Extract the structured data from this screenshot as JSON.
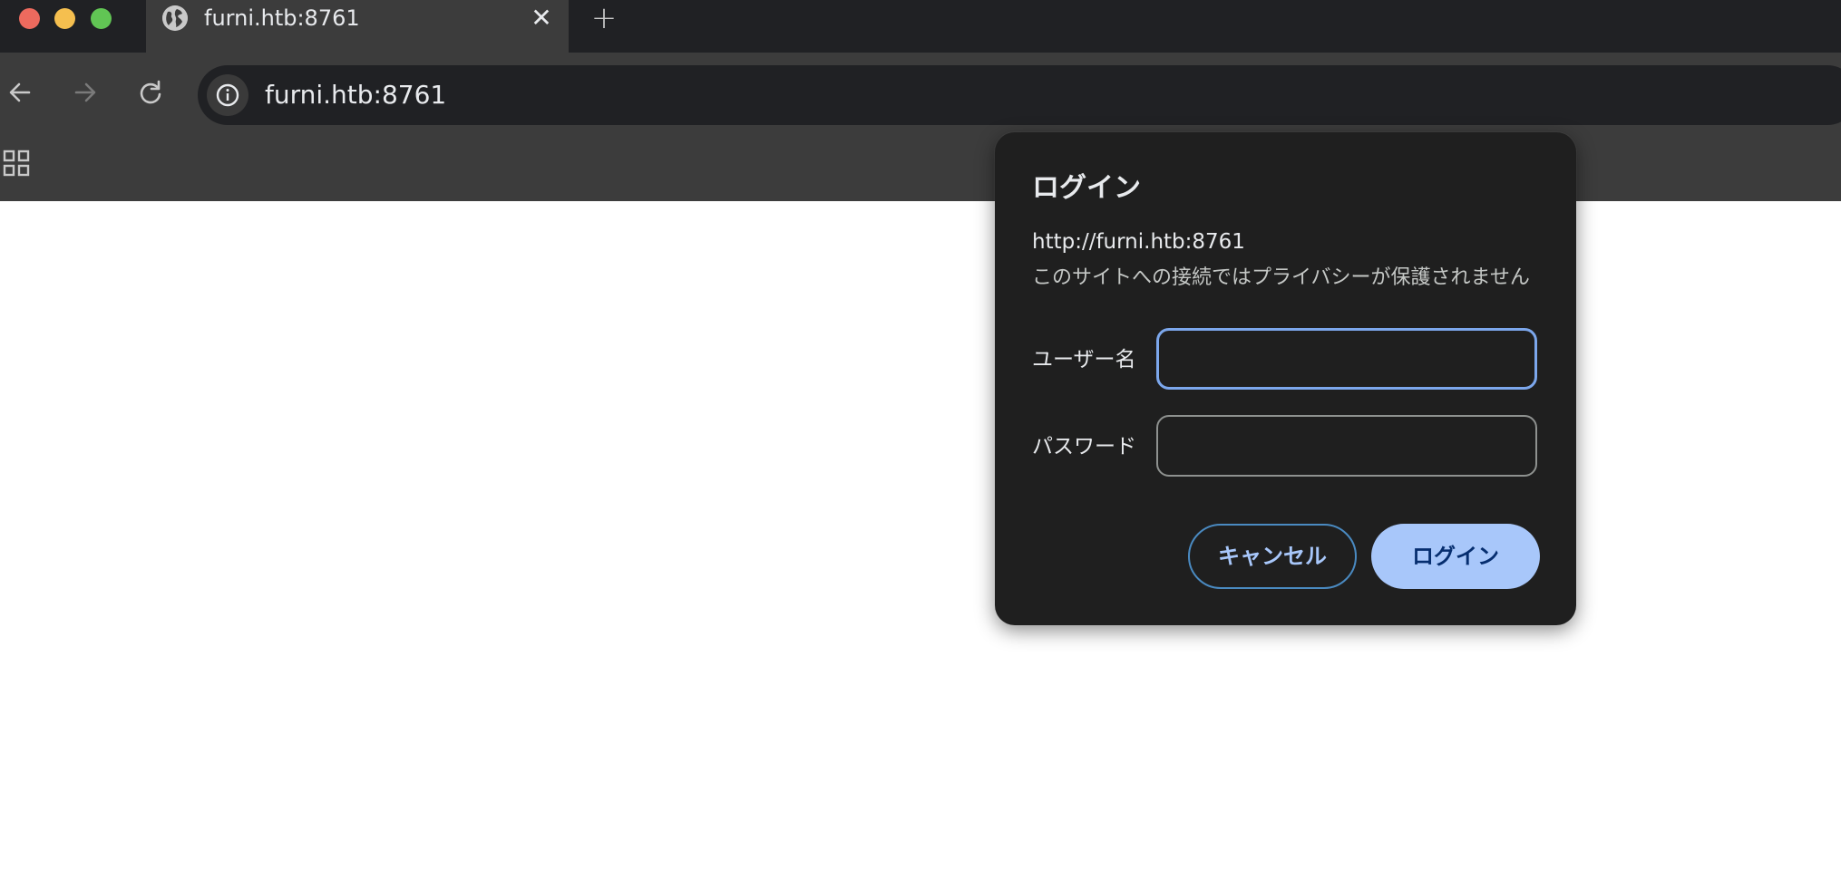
{
  "colors": {
    "tabstrip": "#202124",
    "toolbar": "#3c3c3c",
    "dialog_bg": "#1f1f1f",
    "accent": "#a8c7fa",
    "focus_ring": "#7ca7ec"
  },
  "tab": {
    "icon": "globe-icon",
    "title": "furni.htb:8761",
    "close_icon": "close-icon",
    "close_glyph": "✕"
  },
  "new_tab": {
    "icon": "plus-icon",
    "glyph": "+"
  },
  "toolbar": {
    "back_icon": "arrow-left-icon",
    "forward_icon": "arrow-right-icon",
    "reload_icon": "reload-icon",
    "site_info_icon": "info-icon",
    "address": "furni.htb:8761"
  },
  "bookmarks": {
    "apps_icon": "apps-grid-icon"
  },
  "dialog": {
    "title": "ログイン",
    "origin": "http://furni.htb:8761",
    "warning": "このサイトへの接続ではプライバシーが保護されません",
    "username_label": "ユーザー名",
    "username_value": "",
    "password_label": "パスワード",
    "password_value": "",
    "cancel_label": "キャンセル",
    "login_label": "ログイン"
  }
}
